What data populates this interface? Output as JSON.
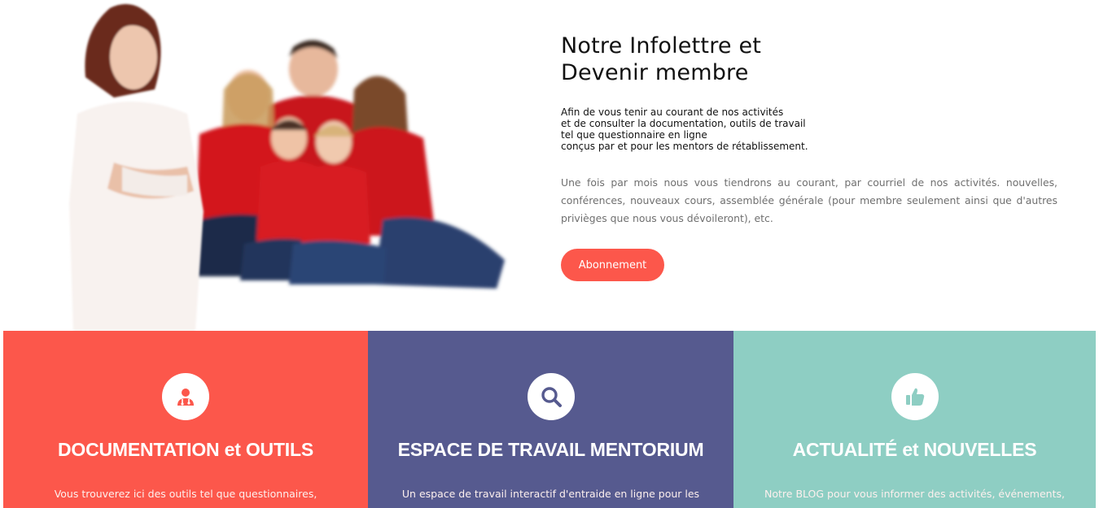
{
  "newsletter": {
    "title_line1": "Notre Infolettre et",
    "title_line2": "Devenir membre",
    "intro_lines": [
      "Afin de vous tenir au courant de nos activités",
      "et de consulter la documentation, outils de travail",
      "tel que questionnaire en ligne",
      "conçus par et pour les mentors de rétablissement."
    ],
    "body": "Une fois par mois nous vous tiendrons au courant, par courriel de nos activités. nouvelles, conférences, nouveaux cours, assemblée générale (pour membre seulement ainsi que d'autres privièges que nous vous dévoileront), etc.",
    "button_label": "Abonnement",
    "button_color": "#fc574b"
  },
  "cards": [
    {
      "title": "DOCUMENTATION et OUTILS",
      "description": "Vous trouverez ici des outils tel que questionnaires,",
      "icon": "doctor-icon",
      "color": "#fc574b"
    },
    {
      "title": "ESPACE DE TRAVAIL MENTORIUM",
      "description": "Un espace de travail interactif d'entraide en ligne pour les",
      "icon": "search-icon",
      "color": "#565a8f"
    },
    {
      "title": "ACTUALITÉ et NOUVELLES",
      "description": "Notre BLOG pour vous informer des activités, événements,",
      "icon": "thumbs-up-icon",
      "color": "#8ecec3"
    }
  ]
}
